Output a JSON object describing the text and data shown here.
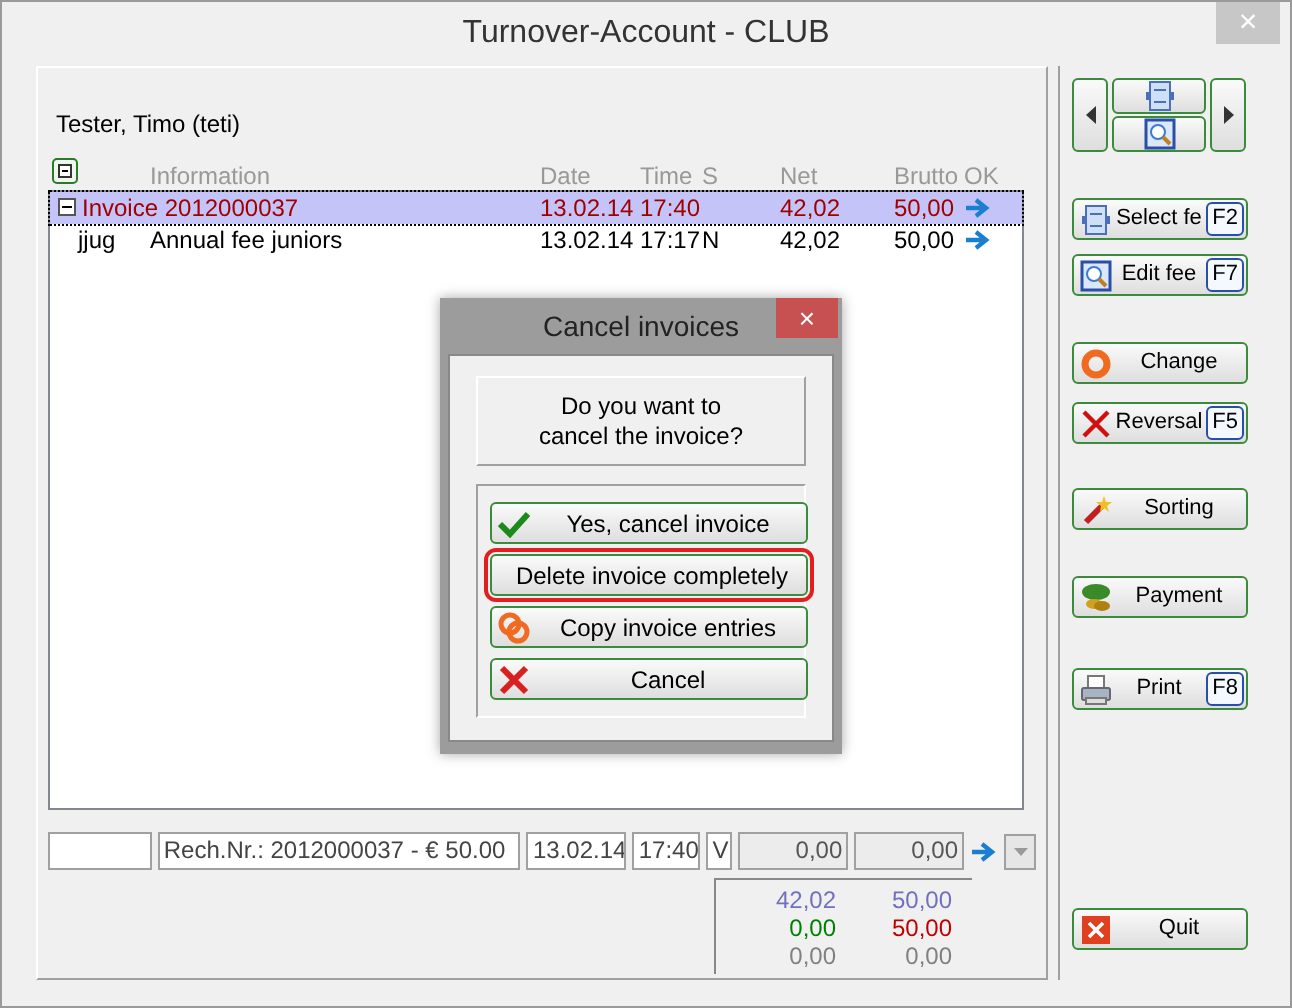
{
  "window": {
    "title": "Turnover-Account - CLUB",
    "close": "×"
  },
  "member": "Tester, Timo (teti)",
  "table": {
    "columns": [
      "Information",
      "Date",
      "Time",
      "S",
      "Net",
      "Brutto",
      "OK"
    ],
    "rows": [
      {
        "information": "Invoice 2012000037",
        "date": "13.02.14",
        "time": "17:40",
        "net": "42,02",
        "brutto": "50,00",
        "expanded": true,
        "selected": true
      },
      {
        "code": "jjug",
        "information": "Annual fee juniors",
        "date": "13.02.14",
        "time": "17:17",
        "s": "N",
        "net": "42,02",
        "brutto": "50,00",
        "expanded": false,
        "selected": false
      }
    ]
  },
  "entry": {
    "reference": "Rech.Nr.: 2012000037 - € 50.00",
    "date": "13.02.14",
    "time": "17:40",
    "s": "V",
    "net": "0,00",
    "brutto": "0,00"
  },
  "totals": [
    {
      "net": "42,02",
      "brutto": "50,00"
    },
    {
      "net": "0,00",
      "brutto": "50,00"
    },
    {
      "net": "0,00",
      "brutto": "0,00"
    }
  ],
  "actions": [
    {
      "label": "Select fe",
      "key": "F2"
    },
    {
      "label": "Edit fee",
      "key": "F7"
    },
    {
      "label": "Change"
    },
    {
      "label": "Reversal",
      "key": "F5"
    },
    {
      "label": "Sorting"
    },
    {
      "label": "Payment"
    },
    {
      "label": "Print",
      "key": "F8"
    },
    {
      "label": "Quit"
    }
  ],
  "dialog": {
    "title": "Cancel invoices",
    "close": "×",
    "message": "Do you want to cancel the invoice?",
    "buttons": [
      {
        "label": "Yes, cancel invoice",
        "focused": false
      },
      {
        "label": "Delete invoice completely",
        "focused": true
      },
      {
        "label": "Copy invoice entries",
        "focused": false
      },
      {
        "label": "Cancel",
        "focused": false
      }
    ]
  }
}
